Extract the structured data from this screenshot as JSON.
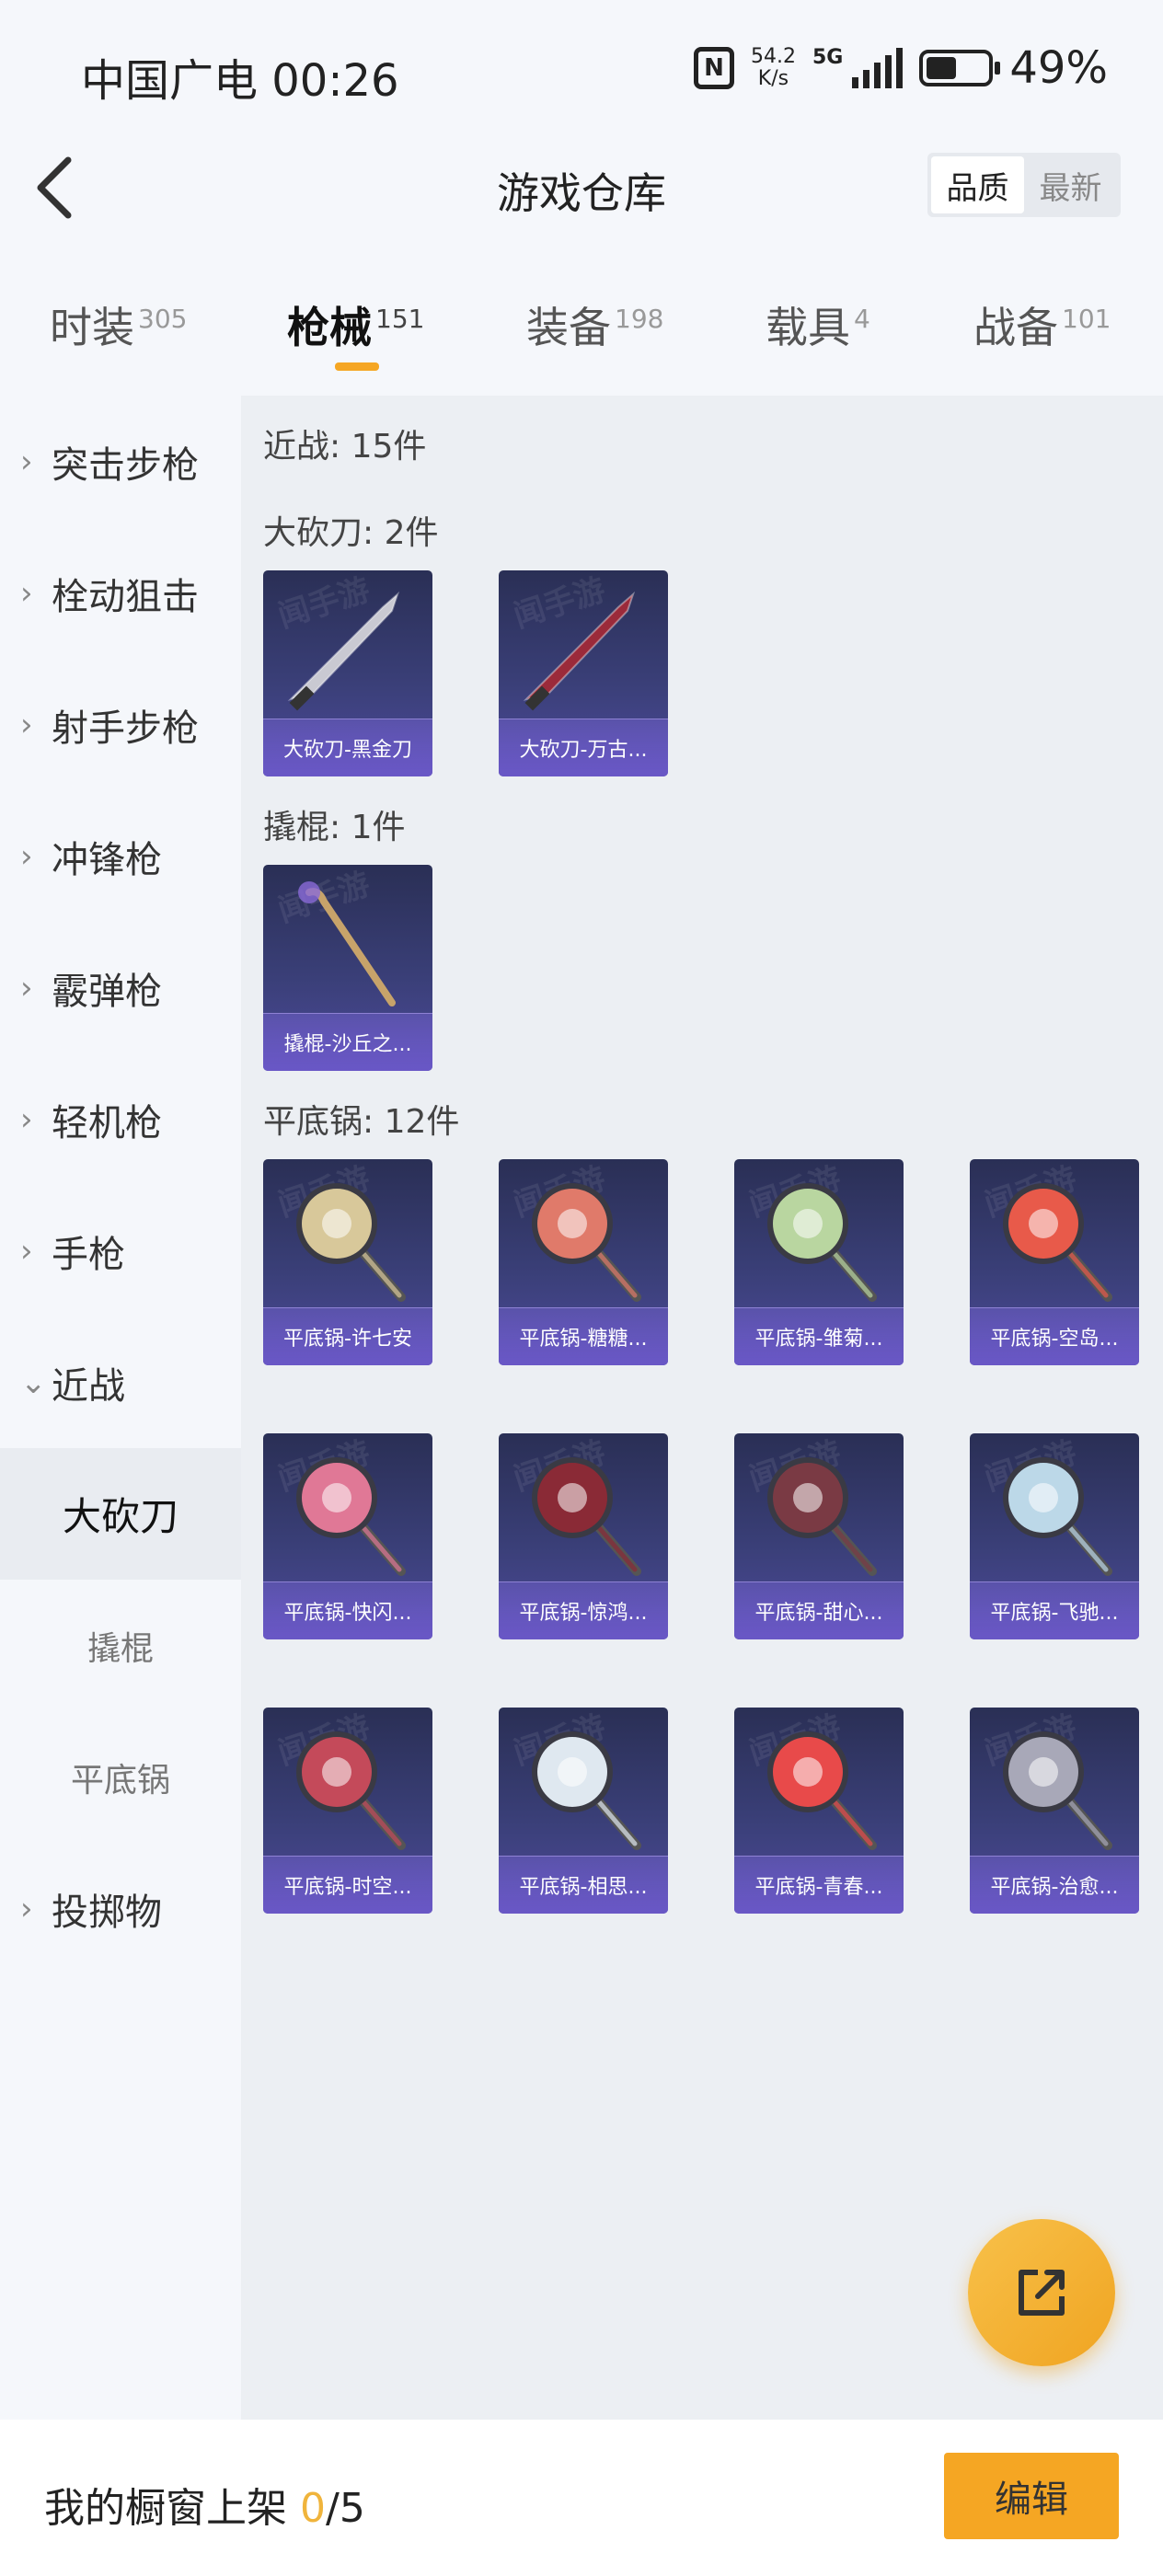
{
  "status_bar": {
    "carrier_time": "中国广电 00:26",
    "nfc": "N",
    "speed_value": "54.2",
    "speed_unit": "K/s",
    "network": "5G",
    "battery": "49%",
    "battery_level": 0.49
  },
  "header": {
    "title": "游戏仓库",
    "sort_options": [
      "品质",
      "最新"
    ]
  },
  "tabs": [
    {
      "label": "时装",
      "count": "305"
    },
    {
      "label": "枪械",
      "count": "151"
    },
    {
      "label": "装备",
      "count": "198"
    },
    {
      "label": "载具",
      "count": "4"
    },
    {
      "label": "战备",
      "count": "101"
    }
  ],
  "sidebar": {
    "categories": [
      "突击步枪",
      "栓动狙击",
      "射手步枪",
      "冲锋枪",
      "霰弹枪",
      "轻机枪",
      "手枪",
      "近战"
    ],
    "subcategories": [
      "大砍刀",
      "撬棍",
      "平底锅"
    ],
    "last_category": "投掷物"
  },
  "content": {
    "summary": "近战: 15件",
    "sections": [
      {
        "title": "大砍刀: 2件",
        "items": [
          "大砍刀-黑金刀",
          "大砍刀-万古..."
        ]
      },
      {
        "title": "撬棍: 1件",
        "items": [
          "撬棍-沙丘之..."
        ]
      },
      {
        "title": "平底锅: 12件",
        "items": [
          "平底锅-许七安",
          "平底锅-糖糖...",
          "平底锅-雏菊...",
          "平底锅-空岛...",
          "平底锅-快闪...",
          "平底锅-惊鸿...",
          "平底锅-甜心...",
          "平底锅-飞驰...",
          "平底锅-时空...",
          "平底锅-相思...",
          "平底锅-青春...",
          "平底锅-治愈..."
        ]
      }
    ],
    "watermark": "闻手游"
  },
  "bottom_bar": {
    "label": "我的橱窗上架",
    "count": "0",
    "total": "/5",
    "edit_label": "编辑"
  },
  "colors": {
    "accent": "#f5a623",
    "card_bg": "#3a3f78",
    "caption_bg": "#6957c6"
  }
}
